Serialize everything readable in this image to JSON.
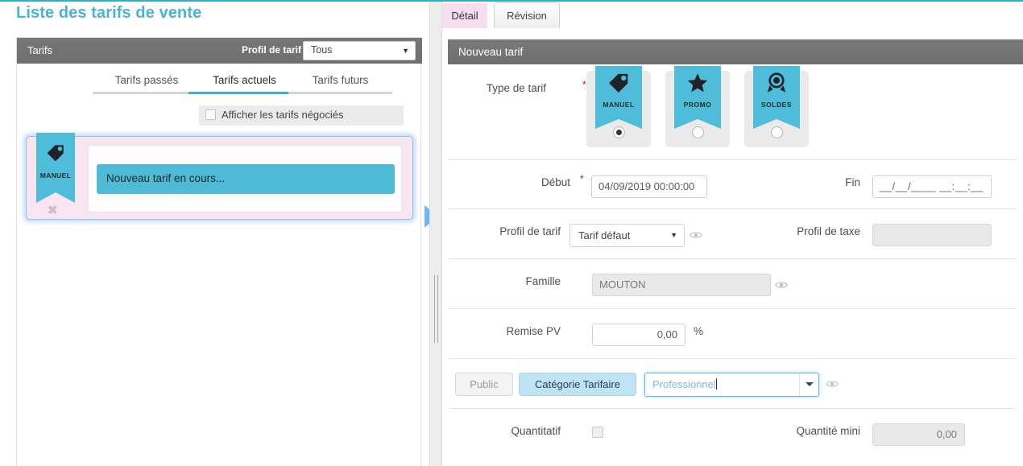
{
  "theme": {
    "accent": "#4ab3cd",
    "ribbon": "#4fbcd9",
    "active_tab_pink": "#f7ddef",
    "required_star": "#d0021b"
  },
  "left": {
    "page_title": "Liste des tarifs de vente",
    "panel_header": {
      "title": "Tarifs",
      "filter_label": "Profil de tarif",
      "filter_value": "Tous"
    },
    "tabs": [
      {
        "label": "Tarifs passés",
        "active": false
      },
      {
        "label": "Tarifs actuels",
        "active": true
      },
      {
        "label": "Tarifs futurs",
        "active": false
      }
    ],
    "negotiated_checkbox": {
      "label": "Afficher les tarifs négociés",
      "checked": false
    },
    "tariff_card": {
      "ribbon_label": "MANUEL",
      "ribbon_icon": "price-tag-icon",
      "band_text": "Nouveau tarif en cours...",
      "close_glyph": "✖"
    }
  },
  "right": {
    "tabs": [
      {
        "label": "Détail",
        "active": true
      },
      {
        "label": "Révision",
        "active": false
      }
    ],
    "section_header": "Nouveau tarif",
    "type_de_tarif": {
      "label": "Type de tarif",
      "required": "*",
      "options": [
        {
          "label": "MANUEL",
          "icon": "price-tag-icon",
          "selected": true
        },
        {
          "label": "PROMO",
          "icon": "star-icon",
          "selected": false
        },
        {
          "label": "SOLDES",
          "icon": "award-badge-icon",
          "selected": false
        }
      ]
    },
    "debut": {
      "label": "Début",
      "required": "*",
      "value": "04/09/2019 00:00:00"
    },
    "fin": {
      "label": "Fin",
      "value": "__/__/____ __:__:__"
    },
    "profil_tarif": {
      "label": "Profil de tarif",
      "value": "Tarif défaut"
    },
    "profil_taxe": {
      "label": "Profil de taxe",
      "value": ""
    },
    "famille": {
      "label": "Famille",
      "value": "MOUTON"
    },
    "remise_pv": {
      "label": "Remise PV",
      "value": "0,00",
      "unit": "%"
    },
    "categorie": {
      "public_label": "Public",
      "categorie_label": "Catégorie Tarifaire",
      "selected_toggle": "Catégorie Tarifaire",
      "combo_value": "Professionnel"
    },
    "quantitatif": {
      "label": "Quantitatif",
      "checked": false
    },
    "quantite_mini": {
      "label": "Quantité mini",
      "value": "0,00"
    }
  },
  "icons": {
    "eye": "eye-icon",
    "caret_down": "▼",
    "collapse_arrow": "collapse-arrow-icon"
  }
}
